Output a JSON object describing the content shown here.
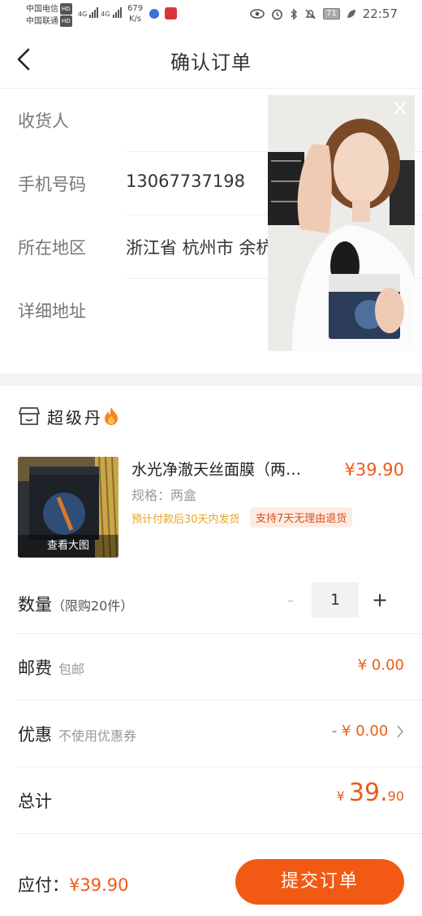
{
  "status_bar": {
    "carrier1": "中国电信",
    "carrier2": "中国联通",
    "hd": "HD",
    "net1": "4G",
    "net2": "4G",
    "speed_value": "679",
    "speed_unit": "K/s",
    "battery": "71",
    "time": "22:57"
  },
  "header": {
    "title": "确认订单"
  },
  "address": {
    "consignee_label": "收货人",
    "consignee_value": "",
    "phone_label": "手机号码",
    "phone_value": "13067737198",
    "region_label": "所在地区",
    "region_value": "浙江省 杭州市 余杭",
    "detail_label": "详细地址",
    "detail_value": ""
  },
  "shop": {
    "name": "超级丹"
  },
  "product": {
    "name": "水光净澈天丝面膜（两…",
    "price": "¥39.90",
    "spec": "规格：两盒",
    "shipping_note": "预计付款后30天内发货",
    "return_tag": "支持7天无理由退货",
    "thumb_caption": "查看大图"
  },
  "quantity": {
    "label": "数量",
    "limit": "（限购20件）",
    "value": "1",
    "minus": "-",
    "plus": "+"
  },
  "postage": {
    "label": "邮费",
    "sub": "包邮",
    "value": "¥ 0.00"
  },
  "discount": {
    "label": "优惠",
    "sub": "不使用优惠券",
    "value": "- ¥ 0.00"
  },
  "total": {
    "label": "总计",
    "symbol": "¥",
    "integer": "39.",
    "decimal": "90"
  },
  "bottom_bar": {
    "pay_label": "应付：",
    "pay_value": "¥39.90",
    "submit_label": "提交订单"
  },
  "colors": {
    "accent": "#f25a14",
    "price": "#ef5a18",
    "ship_note": "#e8a421"
  }
}
